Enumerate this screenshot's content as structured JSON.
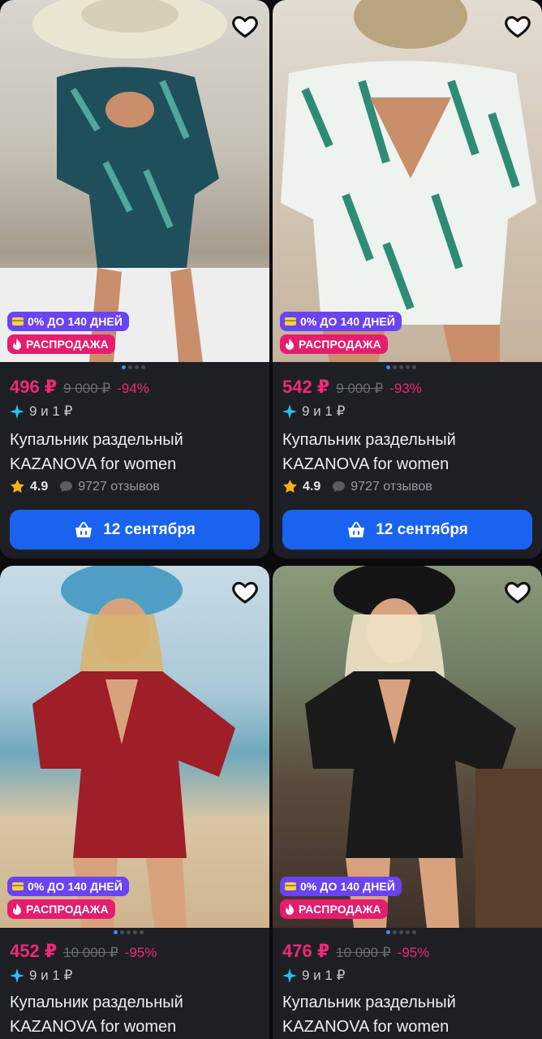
{
  "colors": {
    "background": "#0b0b0d",
    "card": "#1e1f24",
    "price": "#f0287a",
    "installment_badge": "#6a43f2",
    "sale_badge": "#e61c6e",
    "cta": "#1a63f0"
  },
  "products": [
    {
      "installment": "0% ДО 140 ДНЕЙ",
      "sale": "РАСПРОДАЖА",
      "price": "496 ₽",
      "old_price": "9 000 ₽",
      "discount": "-94%",
      "points": "9 и 1 ₽",
      "title_line1": "Купальник раздельный",
      "title_line2": "KAZANOVA for women",
      "rating": "4.9",
      "reviews": "9727 отзывов",
      "delivery": "12 сентября",
      "image_dots": 4,
      "active_dot": 0
    },
    {
      "installment": "0% ДО 140 ДНЕЙ",
      "sale": "РАСПРОДАЖА",
      "price": "542 ₽",
      "old_price": "9 000 ₽",
      "discount": "-93%",
      "points": "9 и 1 ₽",
      "title_line1": "Купальник раздельный",
      "title_line2": "KAZANOVA for women",
      "rating": "4.9",
      "reviews": "9727 отзывов",
      "delivery": "12 сентября",
      "image_dots": 5,
      "active_dot": 0
    },
    {
      "installment": "0% ДО 140 ДНЕЙ",
      "sale": "РАСПРОДАЖА",
      "price": "452 ₽",
      "old_price": "10 000 ₽",
      "discount": "-95%",
      "points": "9 и 1 ₽",
      "title_line1": "Купальник раздельный",
      "title_line2": "KAZANOVA for women",
      "image_dots": 5,
      "active_dot": 0
    },
    {
      "installment": "0% ДО 140 ДНЕЙ",
      "sale": "РАСПРОДАЖА",
      "price": "476 ₽",
      "old_price": "10 000 ₽",
      "discount": "-95%",
      "points": "9 и 1 ₽",
      "title_line1": "Купальник раздельный",
      "title_line2": "KAZANOVA for women",
      "image_dots": 5,
      "active_dot": 0
    }
  ],
  "icons": {
    "favorite": "heart-outline-icon",
    "installment": "credit-card-icon",
    "sale": "fire-icon",
    "points": "sparkle-icon",
    "rating": "star-icon",
    "reviews": "chat-bubble-icon",
    "delivery": "basket-icon"
  }
}
